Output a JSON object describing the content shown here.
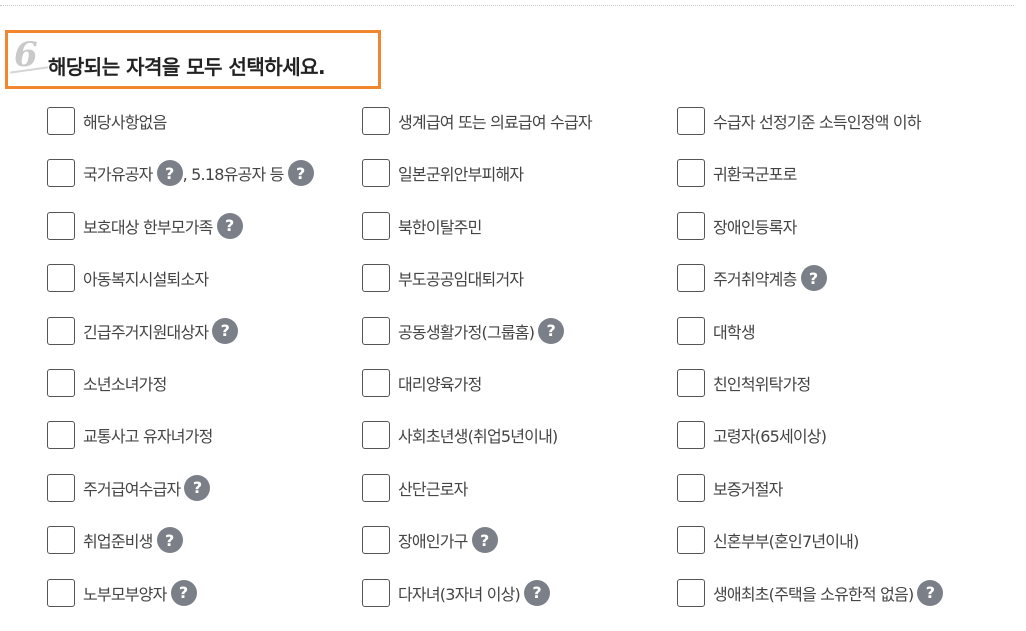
{
  "header": {
    "step_number": "6",
    "title": "해당되는 자격을 모두 선택하세요."
  },
  "help_glyph": "?",
  "options": [
    {
      "segments": [
        {
          "text": "해당사항없음",
          "help": false
        }
      ]
    },
    {
      "segments": [
        {
          "text": "생계급여 또는 의료급여 수급자",
          "help": false
        }
      ]
    },
    {
      "segments": [
        {
          "text": "수급자 선정기준 소득인정액 이하",
          "help": false
        }
      ]
    },
    {
      "segments": [
        {
          "text": "국가유공자",
          "help": true
        },
        {
          "text": ", 5.18유공자 등",
          "help": true
        }
      ]
    },
    {
      "segments": [
        {
          "text": "일본군위안부피해자",
          "help": false
        }
      ]
    },
    {
      "segments": [
        {
          "text": "귀환국군포로",
          "help": false
        }
      ]
    },
    {
      "segments": [
        {
          "text": "보호대상 한부모가족",
          "help": true
        }
      ]
    },
    {
      "segments": [
        {
          "text": "북한이탈주민",
          "help": false
        }
      ]
    },
    {
      "segments": [
        {
          "text": "장애인등록자",
          "help": false
        }
      ]
    },
    {
      "segments": [
        {
          "text": "아동복지시설퇴소자",
          "help": false
        }
      ]
    },
    {
      "segments": [
        {
          "text": "부도공공임대퇴거자",
          "help": false
        }
      ]
    },
    {
      "segments": [
        {
          "text": "주거취약계층",
          "help": true
        }
      ]
    },
    {
      "segments": [
        {
          "text": "긴급주거지원대상자",
          "help": true
        }
      ]
    },
    {
      "segments": [
        {
          "text": "공동생활가정(그룹홈)",
          "help": true
        }
      ]
    },
    {
      "segments": [
        {
          "text": "대학생",
          "help": false
        }
      ]
    },
    {
      "segments": [
        {
          "text": "소년소녀가정",
          "help": false
        }
      ]
    },
    {
      "segments": [
        {
          "text": "대리양육가정",
          "help": false
        }
      ]
    },
    {
      "segments": [
        {
          "text": "친인척위탁가정",
          "help": false
        }
      ]
    },
    {
      "segments": [
        {
          "text": "교통사고 유자녀가정",
          "help": false
        }
      ]
    },
    {
      "segments": [
        {
          "text": "사회초년생(취업5년이내)",
          "help": false
        }
      ]
    },
    {
      "segments": [
        {
          "text": "고령자(65세이상)",
          "help": false
        }
      ]
    },
    {
      "segments": [
        {
          "text": "주거급여수급자",
          "help": true
        }
      ]
    },
    {
      "segments": [
        {
          "text": "산단근로자",
          "help": false
        }
      ]
    },
    {
      "segments": [
        {
          "text": "보증거절자",
          "help": false
        }
      ]
    },
    {
      "segments": [
        {
          "text": "취업준비생",
          "help": true
        }
      ]
    },
    {
      "segments": [
        {
          "text": "장애인가구",
          "help": true
        }
      ]
    },
    {
      "segments": [
        {
          "text": "신혼부부(혼인7년이내)",
          "help": false
        }
      ]
    },
    {
      "segments": [
        {
          "text": "노부모부양자",
          "help": true
        }
      ]
    },
    {
      "segments": [
        {
          "text": "다자녀(3자녀 이상)",
          "help": true
        }
      ]
    },
    {
      "segments": [
        {
          "text": "생애최초(주택을 소유한적 없음)",
          "help": true
        }
      ]
    }
  ]
}
